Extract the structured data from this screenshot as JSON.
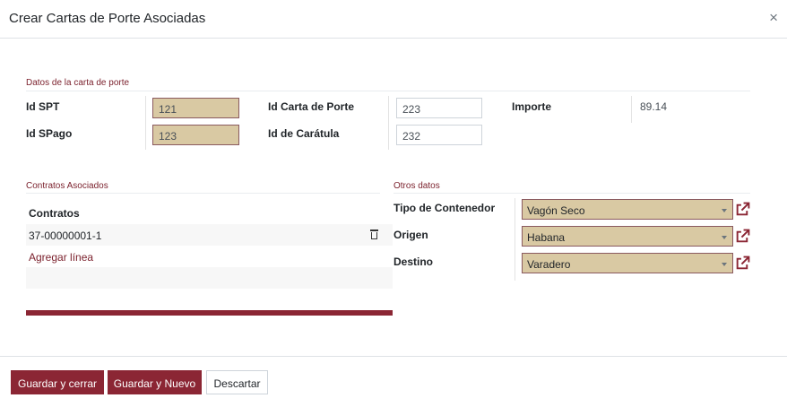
{
  "modal": {
    "title": "Crear Cartas de Porte Asociadas",
    "close": "×"
  },
  "datos": {
    "section_title": "Datos de la carta de porte",
    "id_spt_label": "Id SPT",
    "id_spt_value": "121",
    "id_spago_label": "Id SPago",
    "id_spago_value": "123",
    "id_carta_label": "Id Carta de Porte",
    "id_carta_value": "223",
    "id_caratula_label": "Id de Carátula",
    "id_caratula_value": "232",
    "importe_label": "Importe",
    "importe_value": "89.14"
  },
  "contratos": {
    "section_title": "Contratos Asociados",
    "column_header": "Contratos",
    "rows": [
      "37-00000001-1"
    ],
    "add_line": "Agregar línea"
  },
  "otros": {
    "section_title": "Otros datos",
    "tipo_label": "Tipo de Contenedor",
    "tipo_value": "Vagón Seco",
    "origen_label": "Origen",
    "origen_value": "Habana",
    "destino_label": "Destino",
    "destino_value": "Varadero"
  },
  "footer": {
    "save_close": "Guardar y cerrar",
    "save_new": "Guardar y Nuevo",
    "discard": "Descartar"
  },
  "colors": {
    "accent": "#8b2634",
    "readonly_bg": "#d9c9a3",
    "section_title": "#7a1f2b"
  }
}
